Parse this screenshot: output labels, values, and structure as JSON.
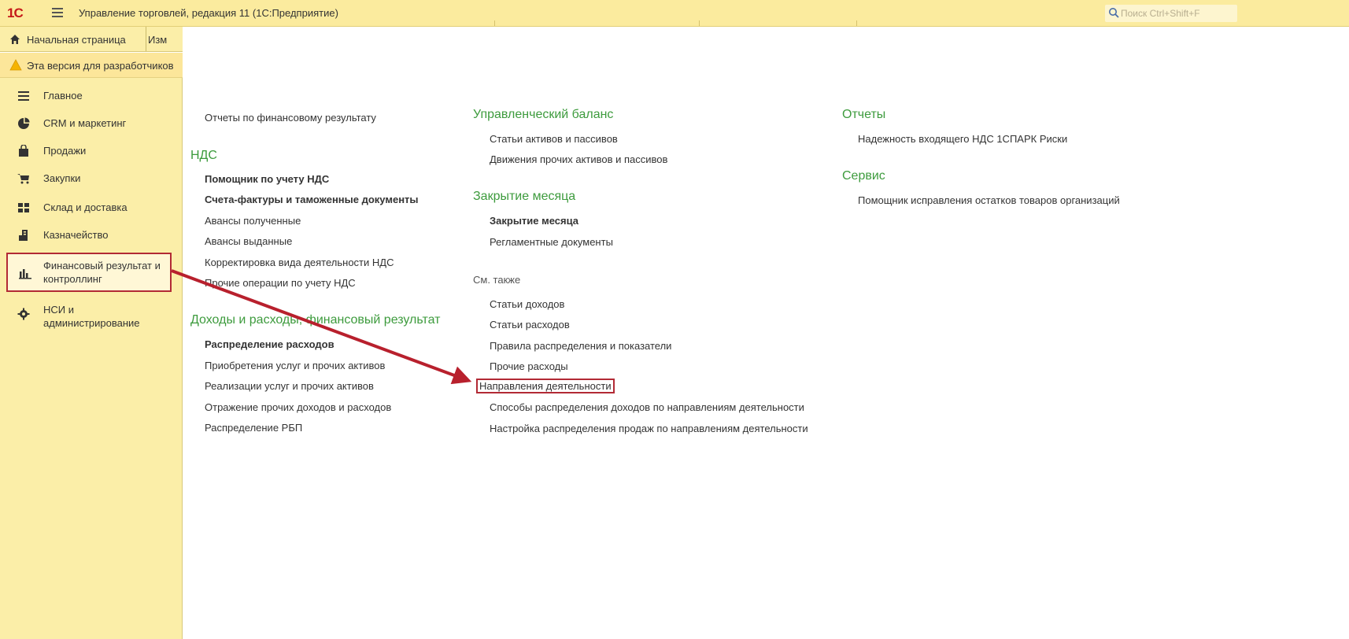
{
  "titlebar": {
    "logo_text": "1С",
    "title": "Управление торговлей, редакция 11  (1С:Предприятие)",
    "search_placeholder": "Поиск Ctrl+Shift+F"
  },
  "tabs": {
    "home_label": "Начальная страница",
    "other_label": "Изм"
  },
  "warning": {
    "text": "Эта версия для разработчиков"
  },
  "sidebar": {
    "items": [
      {
        "label": "Главное",
        "icon": "list-icon"
      },
      {
        "label": "CRM и маркетинг",
        "icon": "pie-chart-icon"
      },
      {
        "label": "Продажи",
        "icon": "bag-icon"
      },
      {
        "label": "Закупки",
        "icon": "cart-icon"
      },
      {
        "label": "Склад и доставка",
        "icon": "warehouse-icon"
      },
      {
        "label": "Казначейство",
        "icon": "treasury-icon"
      },
      {
        "label": "Финансовый результат и контроллинг",
        "icon": "bar-chart-icon",
        "active": true
      },
      {
        "label": "НСИ и администрирование",
        "icon": "gear-icon"
      }
    ]
  },
  "col1": {
    "top_link": "Отчеты по финансовому результату",
    "nds": {
      "header": "НДС",
      "links": [
        "Помощник по учету НДС",
        "Счета-фактуры и таможенные документы",
        "Авансы полученные",
        "Авансы выданные",
        "Корректировка вида деятельности НДС",
        "Прочие операции по учету НДС"
      ]
    },
    "income": {
      "header": "Доходы и расходы, финансовый результат",
      "links": [
        "Распределение расходов",
        "Приобретения услуг и прочих активов",
        "Реализации услуг и прочих активов",
        "Отражение прочих доходов и расходов",
        "Распределение РБП"
      ]
    }
  },
  "col2": {
    "balance": {
      "header": "Управленческий баланс",
      "links": [
        "Статьи активов и пассивов",
        "Движения прочих активов и пассивов"
      ]
    },
    "closing": {
      "header": "Закрытие месяца",
      "links": [
        "Закрытие месяца",
        "Регламентные документы"
      ]
    },
    "see_also": {
      "label": "См. также",
      "links": [
        "Статьи доходов",
        "Статьи расходов",
        "Правила распределения и показатели",
        "Прочие расходы",
        "Направления деятельности",
        "Способы распределения доходов по направлениям деятельности",
        "Настройка распределения продаж по направлениям деятельности"
      ]
    }
  },
  "col3": {
    "reports": {
      "header": "Отчеты",
      "links": [
        "Надежность входящего НДС 1СПАРК Риски"
      ]
    },
    "service": {
      "header": "Сервис",
      "links": [
        "Помощник исправления остатков товаров организаций"
      ]
    }
  },
  "colors": {
    "titlebar_bg": "#fbeb9e",
    "sidebar_bg": "#fbeea8",
    "header_green": "#3d9b3d",
    "highlight_red": "#b22a35"
  }
}
